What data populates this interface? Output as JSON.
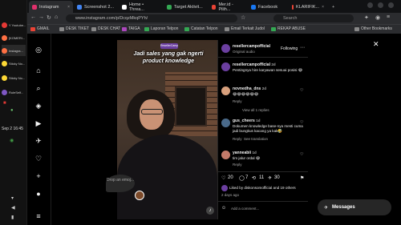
{
  "dock": {
    "items": [
      "Y Youtube...",
      "[KOMERI...",
      "Instagra...",
      "Sticky No...",
      "Sticky No...",
      "RuleSelf..."
    ],
    "time": "Sep 2  16:45"
  },
  "browser": {
    "tabs": [
      {
        "label": "Instagram",
        "color": "#e1306c"
      },
      {
        "label": "Screenshot 2...",
        "color": "#4285f4"
      },
      {
        "label": "Home • Threa...",
        "color": "#ffffff"
      },
      {
        "label": "Target Aktivit...",
        "color": "#34a853"
      },
      {
        "label": "Mer.id - Pilih...",
        "color": "#ea4335"
      },
      {
        "label": "Facebook",
        "color": "#1877f2"
      },
      {
        "label": "KLARIFIK...",
        "color": "#ea4335"
      }
    ],
    "url": "www.instagram.com/p/DcqzMkqPYh/",
    "search_placeholder": "Search",
    "bookmarks": [
      "GMAIL",
      "DESK TIKET",
      "DESK CHAT",
      "TAIGA",
      "Laporan Telpon",
      "Catatan Telpon",
      "Email Terkait Judol",
      "REKAP ABUSE"
    ],
    "other_bookmarks": "Other Bookmarks"
  },
  "post": {
    "caption": "Jadi sales yang gak ngerti product knowledge",
    "brand": "ResellerCamp",
    "drop_text": "Drop an emoj...",
    "author": "resellercampofficial",
    "author_meta": "Original audio",
    "follow_label": "Following",
    "comments": [
      {
        "user": "resellercampofficial",
        "time": "2d",
        "text": "Pentingnya hire karyawan sesuai posisi 😂",
        "reply": "",
        "view": ""
      },
      {
        "user": "novnedha_dns",
        "time": "2d",
        "text": "😂😂😂😂😂😂",
        "reply": "Reply",
        "view": "View all 1 replies"
      },
      {
        "user": "gus_cheers",
        "time": "1d",
        "text": "Dokumen knowledge base-nya mesti cuma jadi bungkus kacang ya kak🤣",
        "reply": "Reply",
        "view": "See translation"
      },
      {
        "user": "yanneabii",
        "time": "1d",
        "text": "tim jalur ordal 😂",
        "reply": "Reply",
        "view": ""
      }
    ],
    "stats": {
      "likes": "20",
      "comments": "7",
      "reposts": "11",
      "shares": "30"
    },
    "liked_by": "Liked by diskonsomofficial and 19 others",
    "ago": "2 days ago",
    "add_comment": "Add a comment...",
    "messages_label": "Messages"
  }
}
